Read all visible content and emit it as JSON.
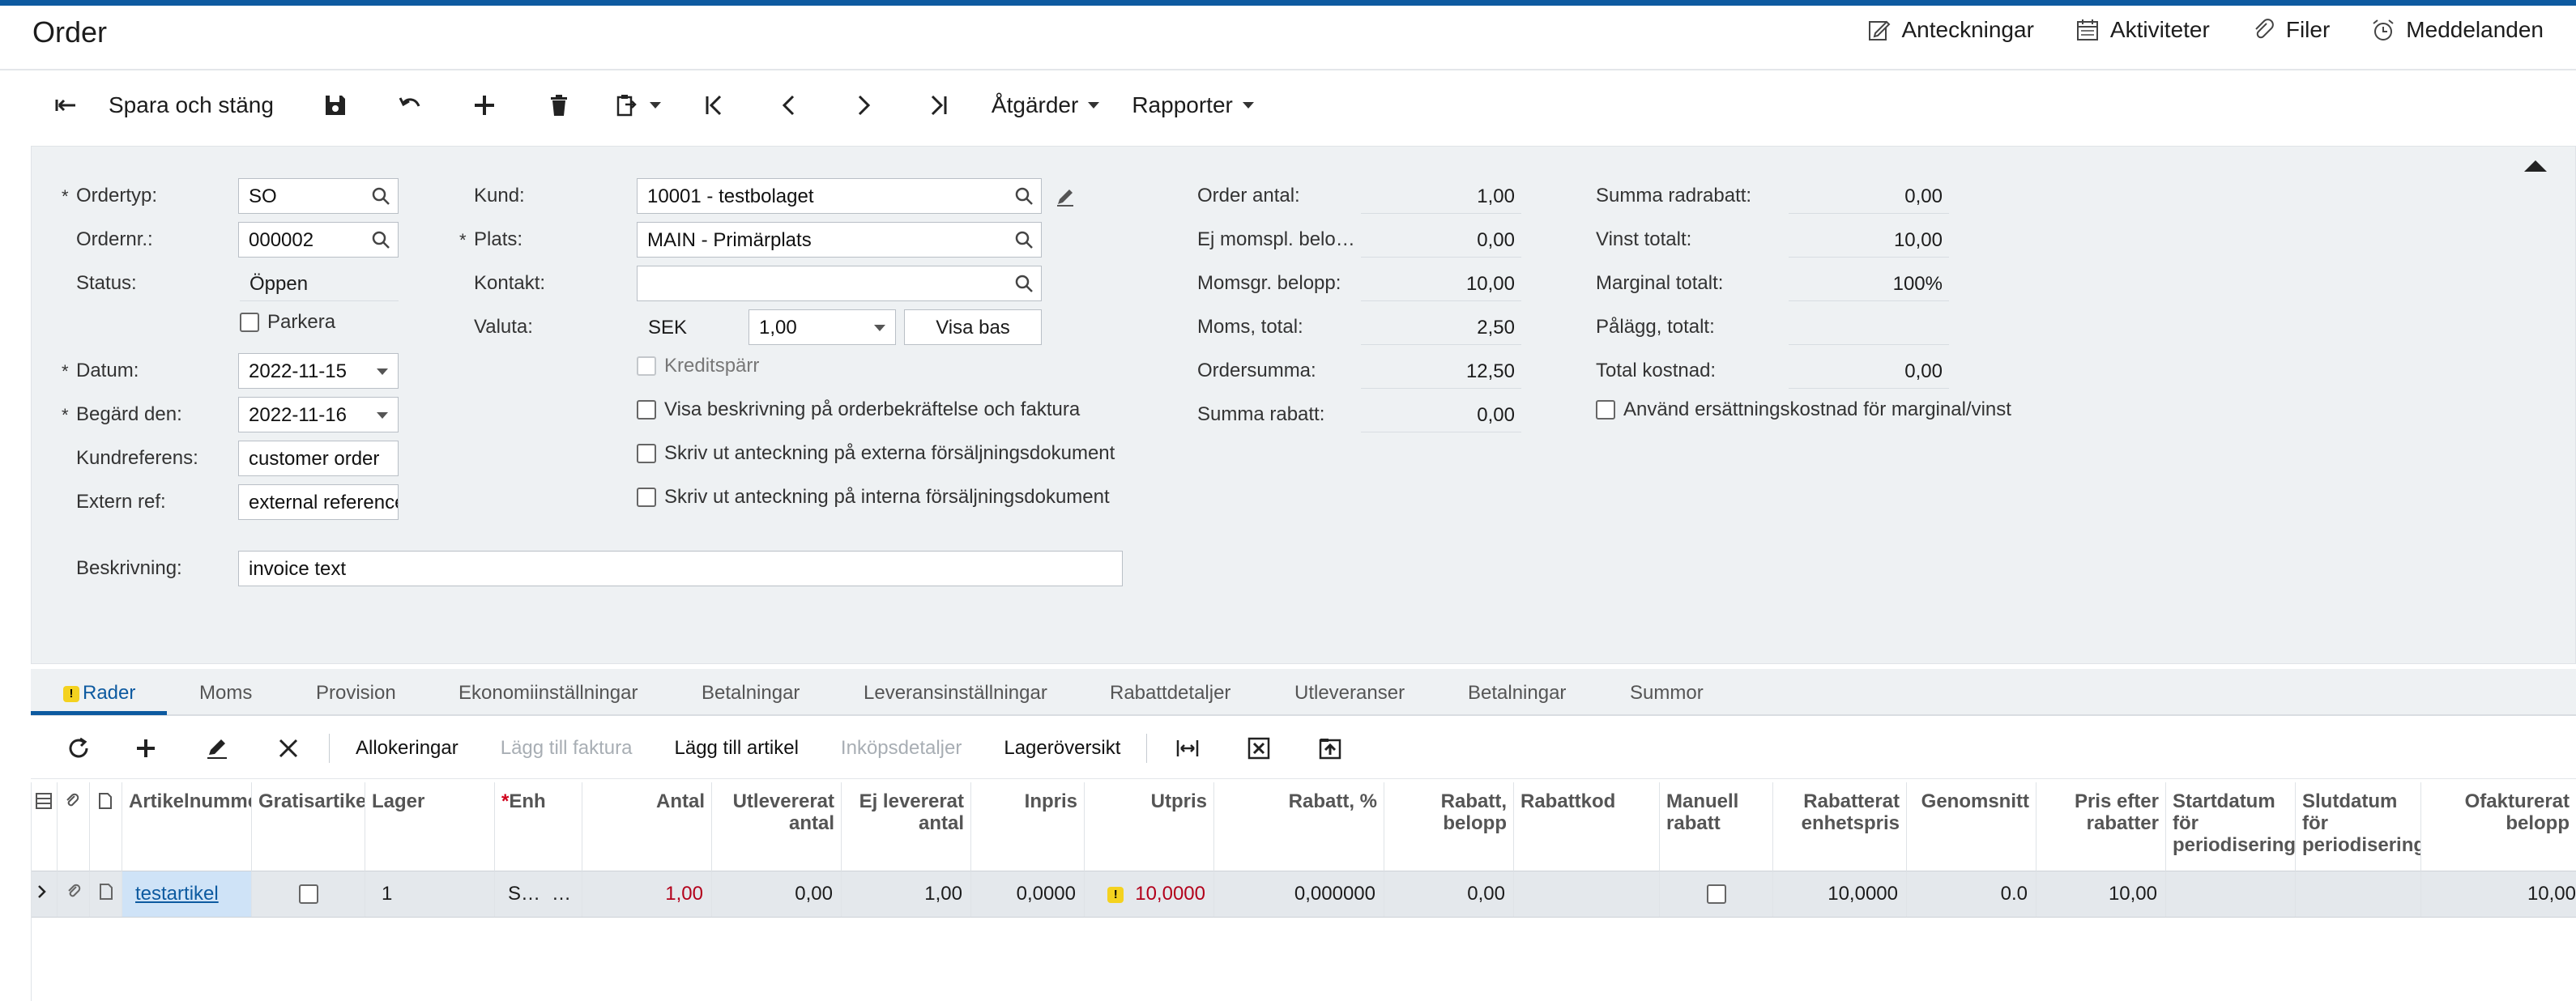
{
  "page": {
    "title": "Order"
  },
  "header_links": [
    {
      "label": "Anteckningar",
      "icon": "notes-icon"
    },
    {
      "label": "Aktiviteter",
      "icon": "calendar-icon"
    },
    {
      "label": "Filer",
      "icon": "paperclip-icon"
    },
    {
      "label": "Meddelanden",
      "icon": "alarm-clock-icon"
    }
  ],
  "toolbar": {
    "save_close_label": "Spara och stäng",
    "actions_label": "Åtgärder",
    "reports_label": "Rapporter"
  },
  "form": {
    "ordertyp": {
      "label": "Ordertyp:",
      "value": "SO"
    },
    "ordernr": {
      "label": "Ordernr.:",
      "value": "000002"
    },
    "status": {
      "label": "Status:",
      "value": "Öppen"
    },
    "parkera": {
      "label": "Parkera",
      "checked": false
    },
    "datum": {
      "label": "Datum:",
      "value": "2022-11-15"
    },
    "begard_den": {
      "label": "Begärd den:",
      "value": "2022-11-16"
    },
    "kundreferens": {
      "label": "Kundreferens:",
      "value": "customer order"
    },
    "extern_ref": {
      "label": "Extern ref:",
      "value": "external reference"
    },
    "beskrivning": {
      "label": "Beskrivning:",
      "value": "invoice text"
    },
    "kund": {
      "label": "Kund:",
      "value": "10001 - testbolaget"
    },
    "plats": {
      "label": "Plats:",
      "value": "MAIN - Primärplats"
    },
    "kontakt": {
      "label": "Kontakt:",
      "value": ""
    },
    "valuta": {
      "label": "Valuta:",
      "code": "SEK",
      "rate": "1,00",
      "base_button": "Visa bas"
    },
    "kreditsparr": {
      "label": "Kreditspärr",
      "checked": false
    },
    "checkboxes": [
      {
        "label": "Visa beskrivning på orderbekräftelse och faktura",
        "checked": false
      },
      {
        "label": "Skriv ut anteckning på externa försäljningsdokument",
        "checked": false
      },
      {
        "label": "Skriv ut anteckning på interna försäljningsdokument",
        "checked": false
      }
    ],
    "totals_left": [
      {
        "label": "Order antal:",
        "value": "1,00"
      },
      {
        "label": "Ej momspl. belo…",
        "value": "0,00"
      },
      {
        "label": "Momsgr. belopp:",
        "value": "10,00"
      },
      {
        "label": "Moms, total:",
        "value": "2,50"
      },
      {
        "label": "Ordersumma:",
        "value": "12,50"
      },
      {
        "label": "Summa rabatt:",
        "value": "0,00"
      }
    ],
    "totals_right": [
      {
        "label": "Summa radrabatt:",
        "value": "0,00"
      },
      {
        "label": "Vinst totalt:",
        "value": "10,00"
      },
      {
        "label": "Marginal totalt:",
        "value": "100%"
      },
      {
        "label": "Pålägg, totalt:",
        "value": ""
      },
      {
        "label": "Total kostnad:",
        "value": "0,00"
      }
    ],
    "replacement_cost": {
      "label": "Använd ersättningskostnad för marginal/vinst",
      "checked": false
    }
  },
  "tabs": [
    "Rader",
    "Moms",
    "Provision",
    "Ekonomiinställningar",
    "Betalningar",
    "Leveransinställningar",
    "Rabattdetaljer",
    "Utleveranser",
    "Betalningar",
    "Summor"
  ],
  "grid_toolbar": {
    "allocations": "Allokeringar",
    "add_to_invoice": "Lägg till faktura",
    "add_item": "Lägg till artikel",
    "purchase_details": "Inköpsdetaljer",
    "stock_overview": "Lageröversikt"
  },
  "grid": {
    "headers": [
      "Artikelnummer",
      "Gratisartikel",
      "Lager",
      "Enh",
      "Antal",
      "Utlevererat antal",
      "Ej levererat antal",
      "Inpris",
      "Utpris",
      "Rabatt, %",
      "Rabatt, belopp",
      "Rabattkod",
      "Manuell rabatt",
      "Rabatterat enhetspris",
      "Genomsnitt",
      "Pris efter rabatter",
      "Startdatum för periodisering",
      "Slutdatum för periodisering",
      "Ofakturerat belopp"
    ],
    "rows": [
      {
        "artikelnummer": "testartikel",
        "gratis": false,
        "lager": "1",
        "enh": "STYCK",
        "antal": "1,00",
        "utlevererat": "0,00",
        "ej_levererat": "1,00",
        "inpris": "0,0000",
        "utpris": "10,0000",
        "rabatt_pct": "0,000000",
        "rabatt_belopp": "0,00",
        "rabattkod": "",
        "manuell": false,
        "rabatterat_pris": "10,0000",
        "genomsnitt": "0.0",
        "pris_efter": "10,00",
        "start": "",
        "slut": "",
        "ofakturerat": "10,00"
      }
    ]
  },
  "colors": {
    "accent": "#0d5aa0",
    "warning": "#f4d21f",
    "error_text": "#b3001b"
  }
}
